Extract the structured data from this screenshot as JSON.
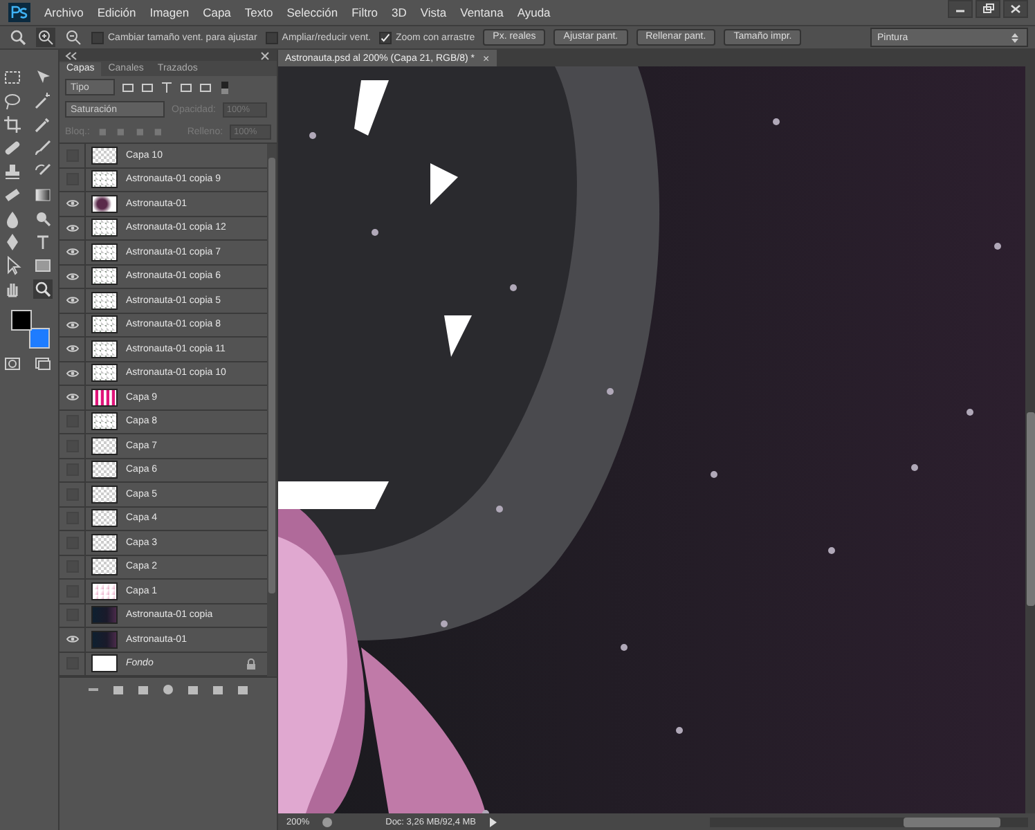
{
  "menu": [
    "Archivo",
    "Edición",
    "Imagen",
    "Capa",
    "Texto",
    "Selección",
    "Filtro",
    "3D",
    "Vista",
    "Ventana",
    "Ayuda"
  ],
  "options": {
    "checkboxes": [
      {
        "label": "Cambiar tamaño vent. para ajustar",
        "checked": false
      },
      {
        "label": "Ampliar/reducir vent.",
        "checked": false
      },
      {
        "label": "Zoom con arrastre",
        "checked": true
      }
    ],
    "buttons": [
      "Px. reales",
      "Ajustar pant.",
      "Rellenar pant.",
      "Tamaño impr."
    ],
    "workspace": "Pintura"
  },
  "panel": {
    "tabs": [
      {
        "label": "Capas",
        "selected": true
      },
      {
        "label": "Canales",
        "selected": false
      },
      {
        "label": "Trazados",
        "selected": false
      }
    ],
    "filter": "Tipo",
    "blend_mode": "Saturación",
    "opacity_label": "Opacidad:",
    "opacity": "100%",
    "lock_label": "Bloq.:",
    "fill_label": "Relleno:",
    "fill": "100%"
  },
  "layers": [
    {
      "name": "Capa 10",
      "visible": false,
      "kind": "transparent",
      "locked": false
    },
    {
      "name": "Astronauta-01 copia 9",
      "visible": false,
      "kind": "figure",
      "locked": false
    },
    {
      "name": "Astronauta-01",
      "visible": true,
      "kind": "purple",
      "locked": false
    },
    {
      "name": "Astronauta-01 copia 12",
      "visible": true,
      "kind": "figure",
      "locked": false
    },
    {
      "name": "Astronauta-01 copia 7",
      "visible": true,
      "kind": "figure",
      "locked": false
    },
    {
      "name": "Astronauta-01 copia 6",
      "visible": true,
      "kind": "figure",
      "locked": false
    },
    {
      "name": "Astronauta-01 copia 5",
      "visible": true,
      "kind": "figure",
      "locked": false
    },
    {
      "name": "Astronauta-01 copia 8",
      "visible": true,
      "kind": "figure",
      "locked": false
    },
    {
      "name": "Astronauta-01 copia 11",
      "visible": true,
      "kind": "figure",
      "locked": false
    },
    {
      "name": "Astronauta-01 copia 10",
      "visible": true,
      "kind": "figure",
      "locked": false
    },
    {
      "name": "Capa 9",
      "visible": true,
      "kind": "magenta",
      "locked": false
    },
    {
      "name": "Capa 8",
      "visible": false,
      "kind": "figure",
      "locked": false
    },
    {
      "name": "Capa 7",
      "visible": false,
      "kind": "transparent",
      "locked": false
    },
    {
      "name": "Capa 6",
      "visible": false,
      "kind": "transparent",
      "locked": false
    },
    {
      "name": "Capa 5",
      "visible": false,
      "kind": "transparent",
      "locked": false
    },
    {
      "name": "Capa 4",
      "visible": false,
      "kind": "transparent",
      "locked": false
    },
    {
      "name": "Capa 3",
      "visible": false,
      "kind": "transparent",
      "locked": false
    },
    {
      "name": "Capa 2",
      "visible": false,
      "kind": "transparent",
      "locked": false
    },
    {
      "name": "Capa 1",
      "visible": false,
      "kind": "pink",
      "locked": false
    },
    {
      "name": "Astronauta-01 copia",
      "visible": false,
      "kind": "dark",
      "locked": false
    },
    {
      "name": "Astronauta-01",
      "visible": true,
      "kind": "dark",
      "locked": false
    },
    {
      "name": "Fondo",
      "visible": false,
      "kind": "white",
      "locked": true
    }
  ],
  "document": {
    "tab": "Astronauta.psd al 200% (Capa 21, RGB/8) *",
    "close": "×"
  },
  "status_bar": {
    "zoom": "200%",
    "doc": "Doc: 3,26 MB/92,4 MB"
  }
}
